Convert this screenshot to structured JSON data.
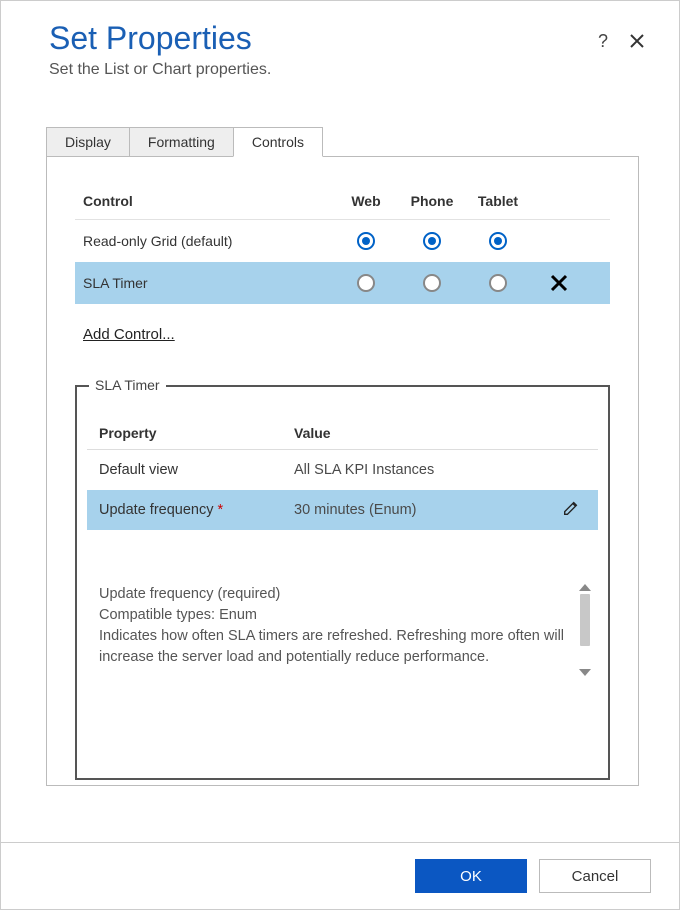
{
  "header": {
    "title": "Set Properties",
    "subtitle": "Set the List or Chart properties."
  },
  "tabs": {
    "items": [
      {
        "label": "Display"
      },
      {
        "label": "Formatting"
      },
      {
        "label": "Controls"
      }
    ],
    "active_index": 2
  },
  "controls_table": {
    "columns": {
      "control": "Control",
      "web": "Web",
      "phone": "Phone",
      "tablet": "Tablet"
    },
    "rows": [
      {
        "name": "Read-only Grid (default)",
        "web": true,
        "phone": true,
        "tablet": true,
        "removable": false,
        "selected": false
      },
      {
        "name": "SLA Timer",
        "web": false,
        "phone": false,
        "tablet": false,
        "removable": true,
        "selected": true
      }
    ],
    "add_link": "Add Control..."
  },
  "fieldset": {
    "legend": "SLA Timer",
    "columns": {
      "property": "Property",
      "value": "Value"
    },
    "rows": [
      {
        "property": "Default view",
        "value": "All SLA KPI Instances",
        "required": false,
        "editable": false,
        "highlight": false
      },
      {
        "property": "Update frequency",
        "value": "30 minutes (Enum)",
        "required": true,
        "editable": true,
        "highlight": true
      }
    ],
    "description": {
      "line1": "Update frequency (required)",
      "line2": "Compatible types: Enum",
      "line3": "Indicates how often SLA timers are refreshed. Refreshing more often will increase the server load and potentially reduce performance."
    }
  },
  "footer": {
    "ok": "OK",
    "cancel": "Cancel"
  },
  "glyphs": {
    "help": "?",
    "required": " *"
  }
}
